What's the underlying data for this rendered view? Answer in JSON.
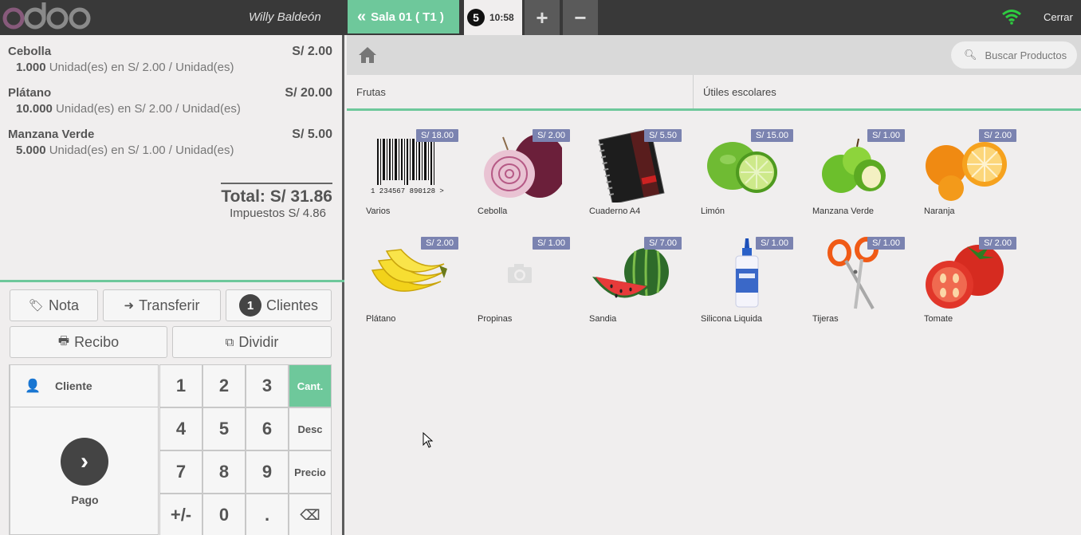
{
  "app": {
    "cashier": "Willy Baldeón",
    "close_label": "Cerrar",
    "colors": {
      "topbar": "#393939",
      "accent": "#6ec89b",
      "price_tag": "#7b83b0",
      "logo": "#875a7b"
    }
  },
  "orders": {
    "active_tab_label": "Sala 01 ( T1 )",
    "tab_badge": "5",
    "tab_time": "10:58",
    "add_label": "+",
    "remove_label": "−"
  },
  "orderlines": [
    {
      "name": "Cebolla",
      "price": "S/ 2.00",
      "qty": "1.000",
      "detail": " Unidad(es) en S/ 2.00 / Unidad(es)"
    },
    {
      "name": "Plátano",
      "price": "S/ 20.00",
      "qty": "10.000",
      "detail": " Unidad(es) en S/ 2.00 / Unidad(es)"
    },
    {
      "name": "Manzana Verde",
      "price": "S/ 5.00",
      "qty": "5.000",
      "detail": " Unidad(es) en S/ 1.00 / Unidad(es)"
    }
  ],
  "totals": {
    "total": "Total: S/ 31.86",
    "taxes": "Impuestos S/ 4.86"
  },
  "control_buttons": {
    "note": "Nota",
    "transfer": "Transferir",
    "guests_count": "1",
    "guests": "Clientes",
    "receipt": "Recibo",
    "split": "Dividir"
  },
  "actionpad": {
    "customer": "Cliente",
    "payment": "Pago"
  },
  "numpad": {
    "keys": [
      "1",
      "2",
      "3",
      "4",
      "5",
      "6",
      "7",
      "8",
      "9",
      "+/-",
      "0",
      "."
    ],
    "modes": [
      "Cant.",
      "Desc",
      "Precio"
    ],
    "active_mode": "Cant.",
    "backspace": "⌫"
  },
  "search": {
    "placeholder": "Buscar Productos"
  },
  "categories": [
    "Frutas",
    "Útiles escolares"
  ],
  "products": [
    {
      "name": "Varios",
      "price": "S/ 18.00",
      "icon": "barcode-icon"
    },
    {
      "name": "Cebolla",
      "price": "S/ 2.00",
      "icon": "onion-icon"
    },
    {
      "name": "Cuaderno A4",
      "price": "S/ 5.50",
      "icon": "notebook-icon"
    },
    {
      "name": "Limón",
      "price": "S/ 15.00",
      "icon": "lime-icon"
    },
    {
      "name": "Manzana Verde",
      "price": "S/ 1.00",
      "icon": "green-apple-icon"
    },
    {
      "name": "Naranja",
      "price": "S/ 2.00",
      "icon": "orange-icon"
    },
    {
      "name": "Plátano",
      "price": "S/ 2.00",
      "icon": "banana-icon"
    },
    {
      "name": "Propinas",
      "price": "S/ 1.00",
      "icon": "camera-placeholder-icon"
    },
    {
      "name": "Sandia",
      "price": "S/ 7.00",
      "icon": "watermelon-icon"
    },
    {
      "name": "Silicona Liquida",
      "price": "S/ 1.00",
      "icon": "glue-bottle-icon"
    },
    {
      "name": "Tijeras",
      "price": "S/ 1.00",
      "icon": "scissors-icon"
    },
    {
      "name": "Tomate",
      "price": "S/ 2.00",
      "icon": "tomato-icon"
    }
  ],
  "barcode_text": "1  234567  890128  >"
}
